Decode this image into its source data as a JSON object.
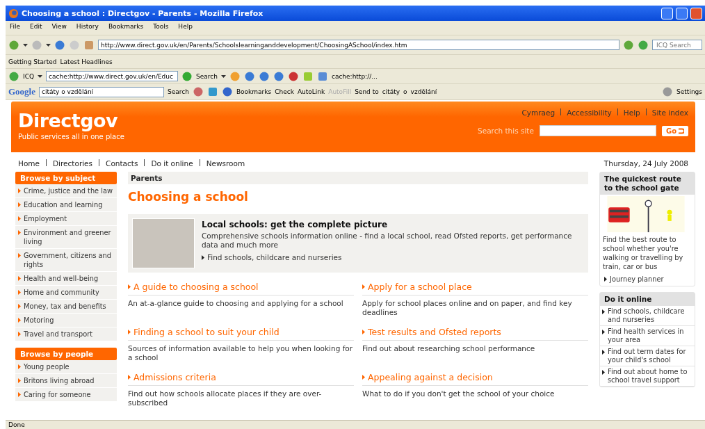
{
  "window": {
    "title": "Choosing a school : Directgov - Parents - Mozilla Firefox"
  },
  "menu": [
    "File",
    "Edit",
    "View",
    "History",
    "Bookmarks",
    "Tools",
    "Help"
  ],
  "nav_toolbar": {
    "address": "http://www.direct.gov.uk/en/Parents/Schoolslearninganddevelopment/ChoosingASchool/index.htm",
    "search_placeholder": "ICQ Search"
  },
  "bookmarks": [
    "Getting Started",
    "Latest Headlines"
  ],
  "icq_toolbar": {
    "label": "ICQ",
    "field": "cache:http://www.direct.gov.uk/en/Educ",
    "search": "Search",
    "link": "cache:http://..."
  },
  "google_toolbar": {
    "logo": "Google",
    "field": "citáty o vzdělání",
    "items": [
      {
        "label": "Search",
        "disabled": false
      },
      {
        "label": "Bookmarks",
        "disabled": false
      },
      {
        "label": "Check",
        "disabled": false
      },
      {
        "label": "AutoLink",
        "disabled": false
      },
      {
        "label": "AutoFill",
        "disabled": true
      },
      {
        "label": "Send to",
        "disabled": false
      },
      {
        "label": "citáty",
        "disabled": false
      },
      {
        "label": "o",
        "disabled": false
      },
      {
        "label": "vzdělání",
        "disabled": false
      }
    ],
    "settings": "Settings"
  },
  "page": {
    "logo": "Directgov",
    "tagline": "Public services all in one place",
    "top_links": [
      "Cymraeg",
      "Accessibility",
      "Help",
      "Site index"
    ],
    "search_label": "Search this site",
    "go": "Go",
    "nav": [
      "Home",
      "Directories",
      "Contacts",
      "Do it online",
      "Newsroom"
    ],
    "date": "Thursday, 24 July 2008",
    "sidebar": [
      {
        "title": "Browse by subject",
        "items": [
          "Crime, justice and the law",
          "Education and learning",
          "Employment",
          "Environment and greener living",
          "Government, citizens and rights",
          "Health and well-being",
          "Home and community",
          "Money, tax and benefits",
          "Motoring",
          "Travel and transport"
        ]
      },
      {
        "title": "Browse by people",
        "items": [
          "Young people",
          "Britons living abroad",
          "Caring for someone"
        ]
      }
    ],
    "breadcrumb": "Parents",
    "heading": "Choosing a school",
    "feature": {
      "title": "Local schools: get the complete picture",
      "text": "Comprehensive schools information online - find a local school, read Ofsted reports, get performance data and much more",
      "link": "Find schools, childcare and nurseries"
    },
    "links": [
      {
        "title": "A guide to choosing a school",
        "text": "An at-a-glance guide to choosing and applying for a school"
      },
      {
        "title": "Apply for a school place",
        "text": "Apply for school places online and on paper, and find key deadlines"
      },
      {
        "title": "Finding a school to suit your child",
        "text": "Sources of information available to help you when looking for a school"
      },
      {
        "title": "Test results and Ofsted reports",
        "text": "Find out about researching school performance"
      },
      {
        "title": "Admissions criteria",
        "text": "Find out how schools allocate places if they are over-subscribed"
      },
      {
        "title": "Appealing against a decision",
        "text": "What to do if you don't get the school of your choice"
      }
    ],
    "route_box": {
      "title": "The quickest route to the school gate",
      "text": "Find the best route to school whether you're walking or travelling by train, car or bus",
      "link": "Journey planner"
    },
    "online_box": {
      "title": "Do it online",
      "items": [
        "Find schools, childcare and nurseries",
        "Find health services in your area",
        "Find out term dates for your child's school",
        "Find out about home to school travel support"
      ]
    }
  },
  "status_bar": "Done"
}
